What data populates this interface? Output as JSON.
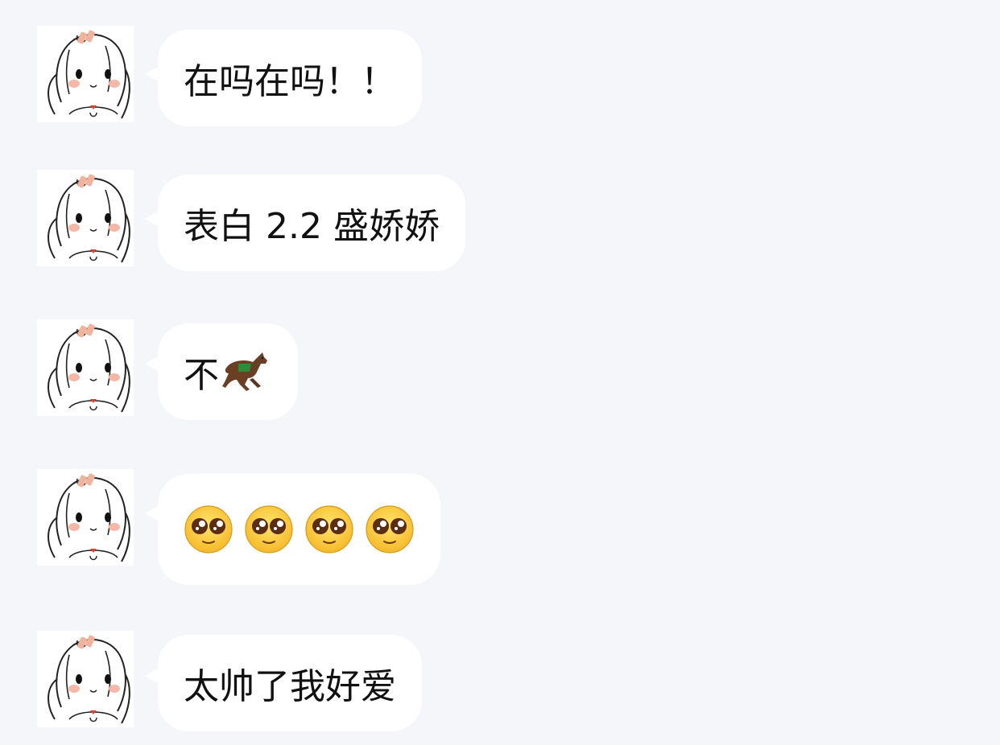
{
  "messages": [
    {
      "text": "在吗在吗！！",
      "icon": null
    },
    {
      "text": "表白 2.2 盛娇娇",
      "icon": null
    },
    {
      "text": "不",
      "icon": "horse-racing-icon"
    },
    {
      "text": "",
      "icon": "pleading-face-icon",
      "icon_count": 4
    },
    {
      "text": "太帅了我好爱",
      "icon": null
    }
  ],
  "colors": {
    "background": "#f5f6fa",
    "bubble": "#ffffff",
    "text": "#111111",
    "blush": "#f6b8a6",
    "heart": "#e0412f"
  }
}
